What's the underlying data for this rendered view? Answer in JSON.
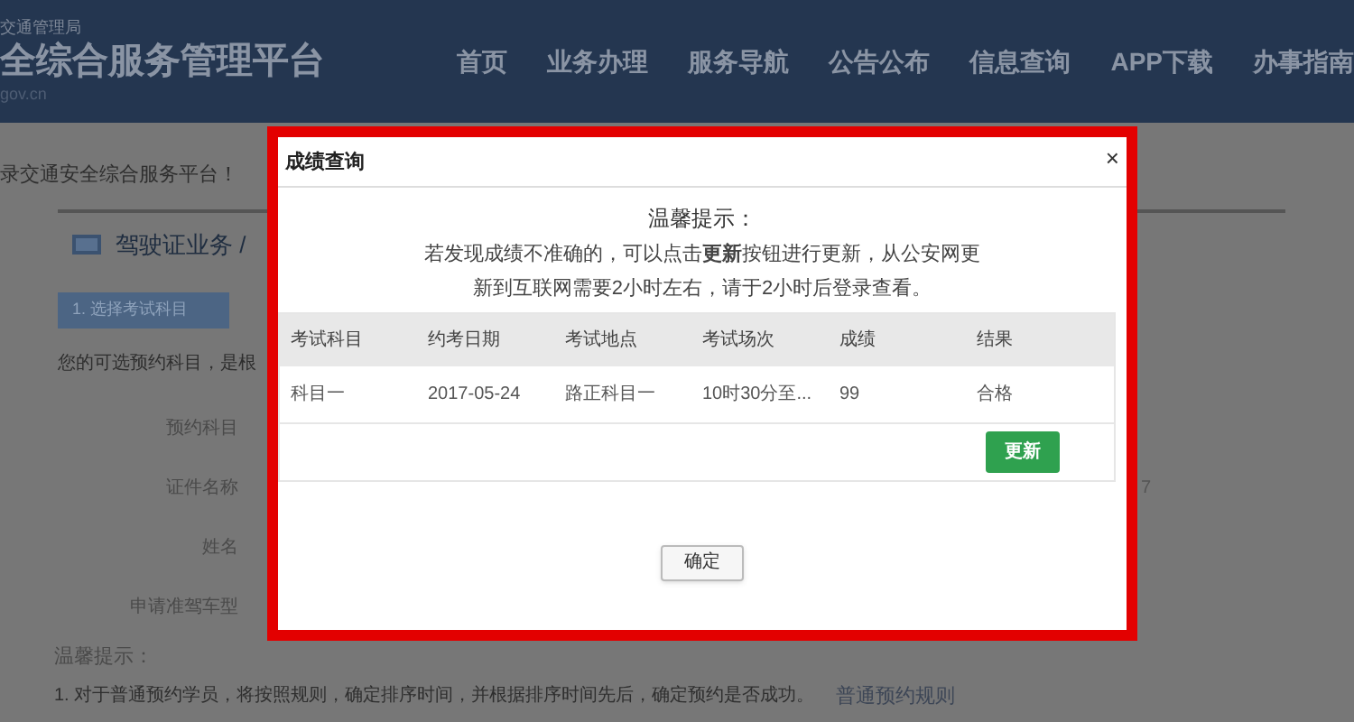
{
  "header": {
    "agency": "交通管理局",
    "site_title": "全综合服务管理平台",
    "domain": "gov.cn",
    "nav": [
      "首页",
      "业务办理",
      "服务导航",
      "公告公布",
      "信息查询",
      "APP下载",
      "办事指南"
    ]
  },
  "page": {
    "welcome": "录交通安全综合服务平台！",
    "breadcrumb": "驾驶证业务 /",
    "step": "1. 选择考试科目",
    "intro": "您的可选预约科目，是根",
    "form_labels": [
      "预约科目",
      "证件名称",
      "姓名",
      "申请准驾车型"
    ],
    "side_value": "7",
    "notice_title": "温馨提示：",
    "notice_text": "1. 对于普通预约学员，将按照规则，确定排序时间，并根据排序时间先后，确定预约是否成功。",
    "rules_link": "普通预约规则"
  },
  "dialog": {
    "title": "成绩查询",
    "close": "×",
    "tip_title": "温馨提示：",
    "tip_lines": [
      "若发现成绩不准确的，可以点击**更新**按钮进行更新，从公安网更",
      "新到互联网需要2小时左右，请于2小时后登录查看。"
    ],
    "table": {
      "columns": [
        "考试科目",
        "约考日期",
        "考试地点",
        "考试场次",
        "成绩",
        "结果"
      ],
      "rows": [
        [
          "科目一",
          "2017-05-24",
          "路正科目一",
          "10时30分至...",
          "99",
          "合格"
        ]
      ]
    },
    "update_button": "更新",
    "ok_button": "确定"
  }
}
